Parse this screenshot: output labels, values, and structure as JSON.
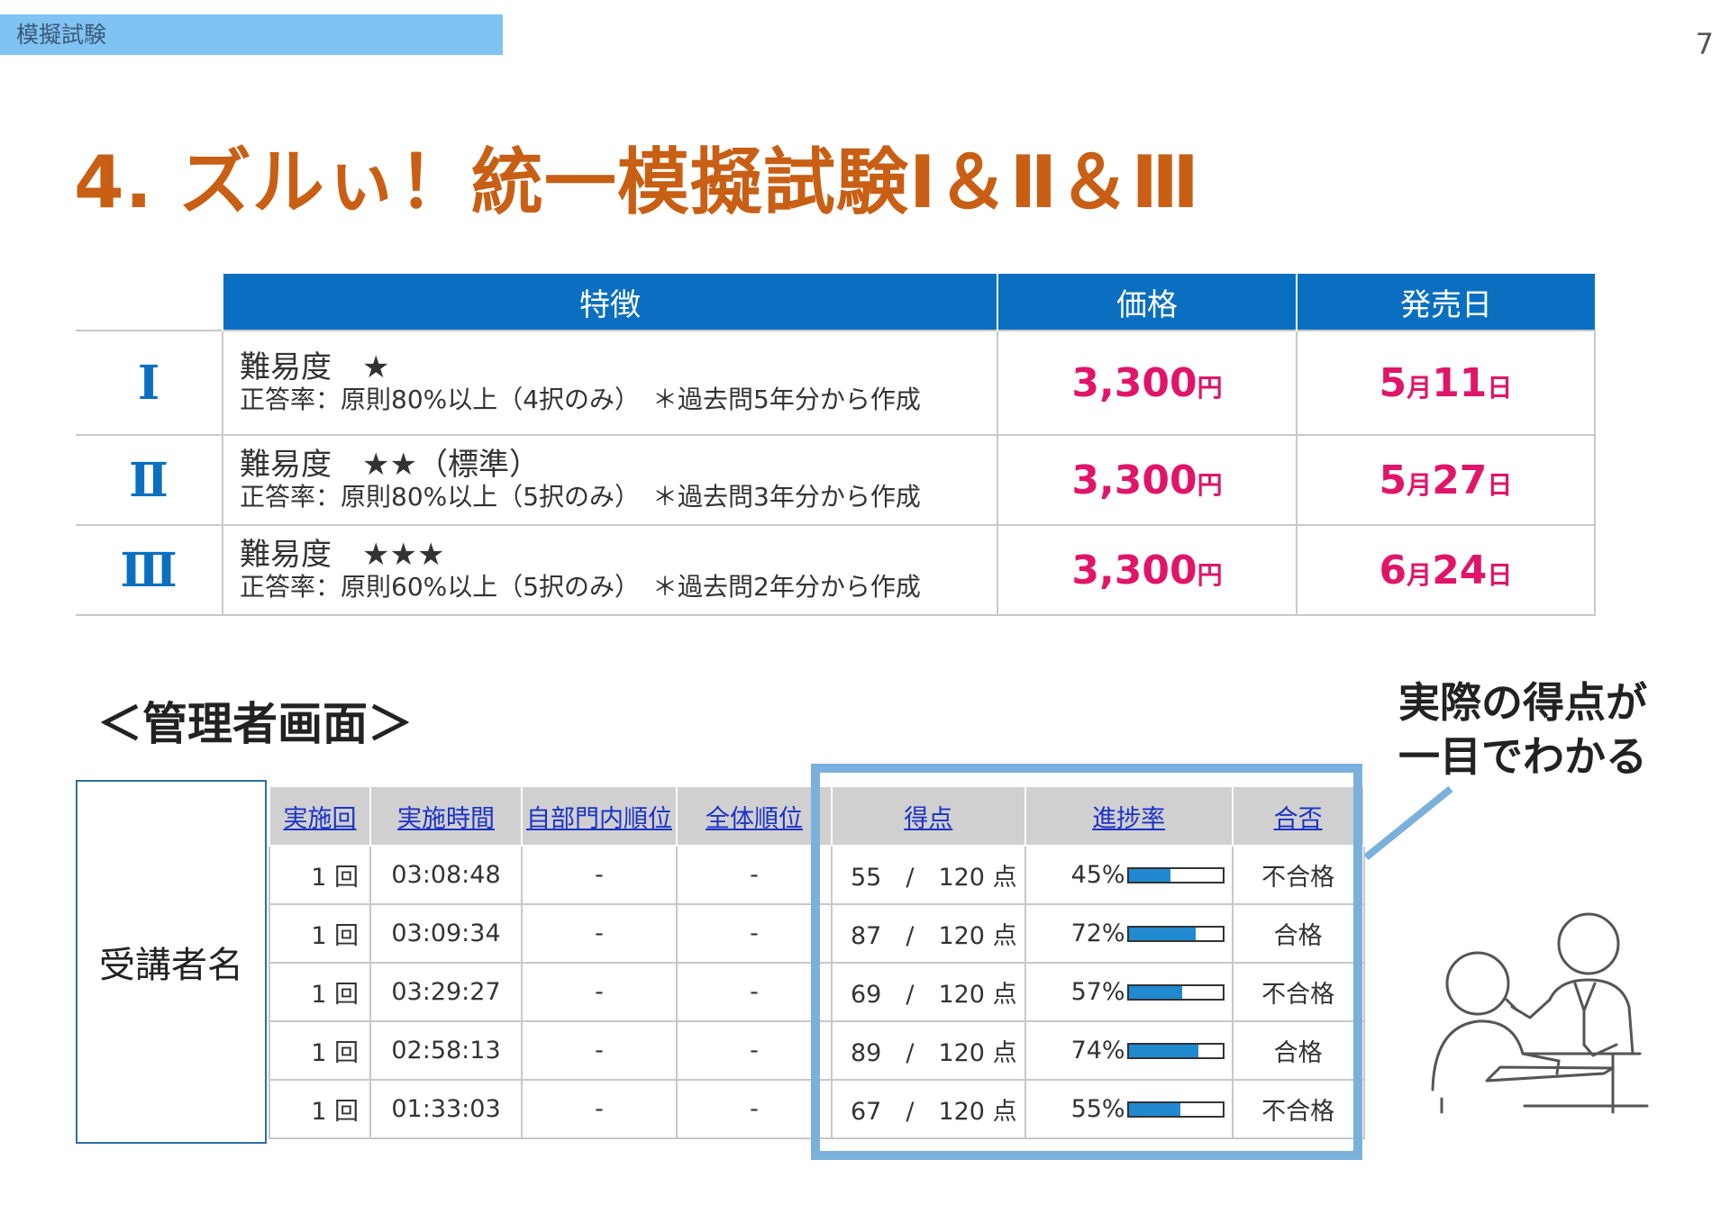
{
  "header": {
    "tag": "模擬試験",
    "page_number": "7"
  },
  "title": "4. ズルぃ！統一模擬試験Ⅰ＆Ⅱ＆Ⅲ",
  "product_table": {
    "headers": [
      "特徴",
      "価格",
      "発売日"
    ],
    "rows": [
      {
        "roman": "Ⅰ",
        "difficulty": "難易度　★",
        "note": "正答率：原則80%以上（4択のみ）　＊過去問5年分から作成",
        "price": "3,300",
        "price_unit": "円",
        "date_month": "5",
        "date_day": "11"
      },
      {
        "roman": "Ⅱ",
        "difficulty": "難易度　★★（標準）",
        "note": "正答率：原則80%以上（5択のみ）　＊過去問3年分から作成",
        "price": "3,300",
        "price_unit": "円",
        "date_month": "5",
        "date_day": "27"
      },
      {
        "roman": "Ⅲ",
        "difficulty": "難易度　★★★",
        "note": "正答率：原則60%以上（5択のみ）　＊過去問2年分から作成",
        "price": "3,300",
        "price_unit": "円",
        "date_month": "6",
        "date_day": "24"
      }
    ],
    "month_unit": "月",
    "day_unit": "日"
  },
  "admin": {
    "title": "＜管理者画面＞",
    "name_label": "受講者名",
    "callout_line1": "実際の得点が",
    "callout_line2": "一目でわかる",
    "headers": [
      "実施回",
      "実施時間",
      "自部門内順位",
      "全体順位",
      "得点",
      "進捗率",
      "合否"
    ],
    "rows": [
      {
        "count": "1 回",
        "time": "03:08:48",
        "dept_rank": "-",
        "overall_rank": "-",
        "score": "55　/　120 点",
        "progress_text": "45%",
        "progress": 45,
        "result": "不合格",
        "pass": false
      },
      {
        "count": "1 回",
        "time": "03:09:34",
        "dept_rank": "-",
        "overall_rank": "-",
        "score": "87　/　120 点",
        "progress_text": "72%",
        "progress": 72,
        "result": "合格",
        "pass": true
      },
      {
        "count": "1 回",
        "time": "03:29:27",
        "dept_rank": "-",
        "overall_rank": "-",
        "score": "69　/　120 点",
        "progress_text": "57%",
        "progress": 57,
        "result": "不合格",
        "pass": false
      },
      {
        "count": "1 回",
        "time": "02:58:13",
        "dept_rank": "-",
        "overall_rank": "-",
        "score": "89　/　120 点",
        "progress_text": "74%",
        "progress": 74,
        "result": "合格",
        "pass": true
      },
      {
        "count": "1 回",
        "time": "01:33:03",
        "dept_rank": "-",
        "overall_rank": "-",
        "score": "67　/　120 点",
        "progress_text": "55%",
        "progress": 55,
        "result": "不合格",
        "pass": false
      }
    ]
  },
  "colors": {
    "title": "#c85f14",
    "header_blue": "#0a6fc0",
    "price_pink": "#e0156a",
    "fail_red": "#e8282a",
    "pass_blue": "#1b32c7",
    "highlight": "#7ab0dc"
  }
}
